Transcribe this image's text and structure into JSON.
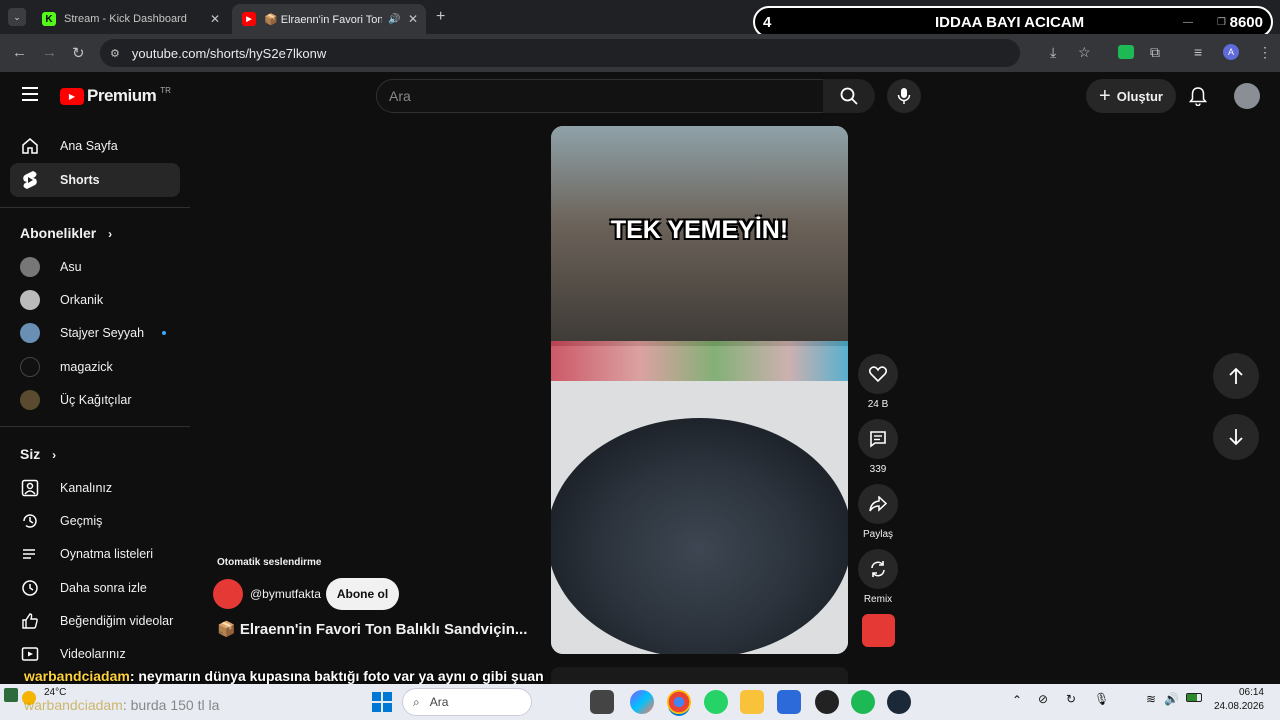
{
  "tabs": [
    {
      "title": "Stream - Kick Dashboard",
      "favicon": "kick-icon"
    },
    {
      "title": "📦 Elraenn'in Favori Ton Balıklı Sandviçi",
      "favicon": "youtube-icon"
    }
  ],
  "overlay": {
    "left": "4",
    "center": "IDDAA BAYI ACICAM",
    "right": "8600"
  },
  "address": {
    "url": "youtube.com/shorts/hyS2e7lkonw"
  },
  "profile": {
    "initial": "A"
  },
  "youtube": {
    "logo": "Premium",
    "region": "TR",
    "search_placeholder": "Ara",
    "create_label": "Oluştur"
  },
  "sidebar": {
    "main": [
      {
        "label": "Ana Sayfa",
        "icon": "home-icon"
      },
      {
        "label": "Shorts",
        "icon": "shorts-icon",
        "selected": true
      }
    ],
    "subscriptions_title": "Abonelikler",
    "subscriptions": [
      {
        "label": "Asu"
      },
      {
        "label": "Orkanik"
      },
      {
        "label": "Stajyer Seyyah",
        "new": true
      },
      {
        "label": "magazick"
      },
      {
        "label": "Üç Kağıtçılar"
      }
    ],
    "you_title": "Siz",
    "you": [
      {
        "label": "Kanalınız",
        "icon": "channel-icon"
      },
      {
        "label": "Geçmiş",
        "icon": "history-icon"
      },
      {
        "label": "Oynatma listeleri",
        "icon": "playlist-icon"
      },
      {
        "label": "Daha sonra izle",
        "icon": "watch-later-icon"
      },
      {
        "label": "Beğendiğim videolar",
        "icon": "like-icon"
      },
      {
        "label": "Videolarınız",
        "icon": "your-videos-icon"
      }
    ]
  },
  "short": {
    "caption_overlay": "TEK YEMEYİN!",
    "auto_dub": "Otomatik seslendirme",
    "channel": "@bymutfakta",
    "subscribe": "Abone ol",
    "title": "📦 Elraenn'in Favori Ton Balıklı Sandviçin...",
    "likes": "24 B",
    "comments": "339",
    "share": "Paylaş",
    "remix": "Remix"
  },
  "chat": [
    {
      "user": "warbandciadam",
      "msg": ": neymarın dünya kupasına baktığı foto var ya aynı o gibi şuan"
    },
    {
      "user": "warbandciadam",
      "msg": ": burda 150 tl la"
    }
  ],
  "taskbar": {
    "weather": "24°C",
    "search": "Ara",
    "time": "06:14",
    "date": "24.08.2026"
  },
  "colors": {
    "youtube_red": "#ff0000",
    "kick_green": "#53fc18",
    "accent_blue": "#3ea6ff"
  }
}
